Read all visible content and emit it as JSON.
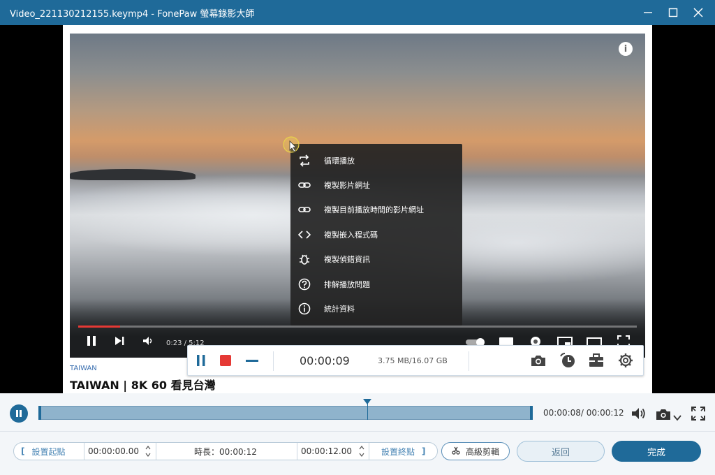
{
  "window": {
    "title": "Video_221130212155.keymp4  -  FonePaw 螢幕錄影大師",
    "controls": [
      "minimize-icon",
      "maximize-icon",
      "close-icon"
    ]
  },
  "video": {
    "progress_fraction": 0.075,
    "time": "0:23 / 5:12",
    "channel": "TAIWAN",
    "title": "TAIWAN | 8K 60 看見台灣"
  },
  "context_menu": {
    "items": [
      {
        "label": "循環播放",
        "icon": "loop-icon"
      },
      {
        "label": "複製影片網址",
        "icon": "link-icon"
      },
      {
        "label": "複製目前播放時間的影片網址",
        "icon": "link-icon"
      },
      {
        "label": "複製嵌入程式碼",
        "icon": "code-icon"
      },
      {
        "label": "複製偵錯資訊",
        "icon": "bug-icon"
      },
      {
        "label": "排解播放問題",
        "icon": "help-icon"
      },
      {
        "label": "統計資料",
        "icon": "info-icon"
      }
    ]
  },
  "recorder_bar": {
    "elapsed": "00:00:09",
    "size": "3.75 MB/16.07 GB"
  },
  "player": {
    "playhead_fraction": 0.665,
    "time_readout": "00:00:08/ 00:00:12"
  },
  "trim": {
    "set_start_label": "設置起點",
    "start_value": "00:00:00.00",
    "duration_label": "時長：00:00:12",
    "end_value": "00:00:12.00",
    "set_end_label": "設置終點",
    "advanced_label": "高級剪輯"
  },
  "actions": {
    "back_label": "返回",
    "done_label": "完成"
  },
  "colors": {
    "accent": "#1f6a99",
    "record_red": "#e53935"
  }
}
